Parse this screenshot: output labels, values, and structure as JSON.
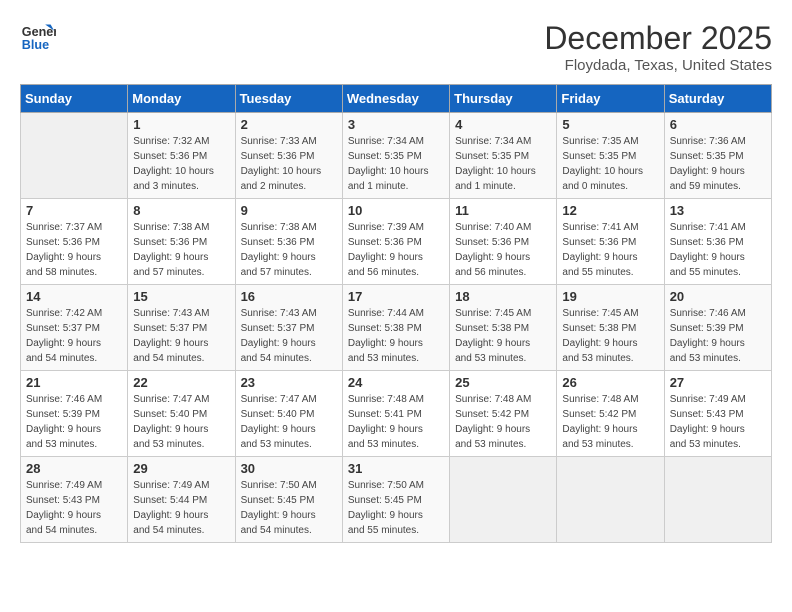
{
  "header": {
    "logo_line1": "General",
    "logo_line2": "Blue",
    "month": "December 2025",
    "location": "Floydada, Texas, United States"
  },
  "days_of_week": [
    "Sunday",
    "Monday",
    "Tuesday",
    "Wednesday",
    "Thursday",
    "Friday",
    "Saturday"
  ],
  "weeks": [
    [
      {
        "num": "",
        "info": ""
      },
      {
        "num": "1",
        "info": "Sunrise: 7:32 AM\nSunset: 5:36 PM\nDaylight: 10 hours\nand 3 minutes."
      },
      {
        "num": "2",
        "info": "Sunrise: 7:33 AM\nSunset: 5:36 PM\nDaylight: 10 hours\nand 2 minutes."
      },
      {
        "num": "3",
        "info": "Sunrise: 7:34 AM\nSunset: 5:35 PM\nDaylight: 10 hours\nand 1 minute."
      },
      {
        "num": "4",
        "info": "Sunrise: 7:34 AM\nSunset: 5:35 PM\nDaylight: 10 hours\nand 1 minute."
      },
      {
        "num": "5",
        "info": "Sunrise: 7:35 AM\nSunset: 5:35 PM\nDaylight: 10 hours\nand 0 minutes."
      },
      {
        "num": "6",
        "info": "Sunrise: 7:36 AM\nSunset: 5:35 PM\nDaylight: 9 hours\nand 59 minutes."
      }
    ],
    [
      {
        "num": "7",
        "info": "Sunrise: 7:37 AM\nSunset: 5:36 PM\nDaylight: 9 hours\nand 58 minutes."
      },
      {
        "num": "8",
        "info": "Sunrise: 7:38 AM\nSunset: 5:36 PM\nDaylight: 9 hours\nand 57 minutes."
      },
      {
        "num": "9",
        "info": "Sunrise: 7:38 AM\nSunset: 5:36 PM\nDaylight: 9 hours\nand 57 minutes."
      },
      {
        "num": "10",
        "info": "Sunrise: 7:39 AM\nSunset: 5:36 PM\nDaylight: 9 hours\nand 56 minutes."
      },
      {
        "num": "11",
        "info": "Sunrise: 7:40 AM\nSunset: 5:36 PM\nDaylight: 9 hours\nand 56 minutes."
      },
      {
        "num": "12",
        "info": "Sunrise: 7:41 AM\nSunset: 5:36 PM\nDaylight: 9 hours\nand 55 minutes."
      },
      {
        "num": "13",
        "info": "Sunrise: 7:41 AM\nSunset: 5:36 PM\nDaylight: 9 hours\nand 55 minutes."
      }
    ],
    [
      {
        "num": "14",
        "info": "Sunrise: 7:42 AM\nSunset: 5:37 PM\nDaylight: 9 hours\nand 54 minutes."
      },
      {
        "num": "15",
        "info": "Sunrise: 7:43 AM\nSunset: 5:37 PM\nDaylight: 9 hours\nand 54 minutes."
      },
      {
        "num": "16",
        "info": "Sunrise: 7:43 AM\nSunset: 5:37 PM\nDaylight: 9 hours\nand 54 minutes."
      },
      {
        "num": "17",
        "info": "Sunrise: 7:44 AM\nSunset: 5:38 PM\nDaylight: 9 hours\nand 53 minutes."
      },
      {
        "num": "18",
        "info": "Sunrise: 7:45 AM\nSunset: 5:38 PM\nDaylight: 9 hours\nand 53 minutes."
      },
      {
        "num": "19",
        "info": "Sunrise: 7:45 AM\nSunset: 5:38 PM\nDaylight: 9 hours\nand 53 minutes."
      },
      {
        "num": "20",
        "info": "Sunrise: 7:46 AM\nSunset: 5:39 PM\nDaylight: 9 hours\nand 53 minutes."
      }
    ],
    [
      {
        "num": "21",
        "info": "Sunrise: 7:46 AM\nSunset: 5:39 PM\nDaylight: 9 hours\nand 53 minutes."
      },
      {
        "num": "22",
        "info": "Sunrise: 7:47 AM\nSunset: 5:40 PM\nDaylight: 9 hours\nand 53 minutes."
      },
      {
        "num": "23",
        "info": "Sunrise: 7:47 AM\nSunset: 5:40 PM\nDaylight: 9 hours\nand 53 minutes."
      },
      {
        "num": "24",
        "info": "Sunrise: 7:48 AM\nSunset: 5:41 PM\nDaylight: 9 hours\nand 53 minutes."
      },
      {
        "num": "25",
        "info": "Sunrise: 7:48 AM\nSunset: 5:42 PM\nDaylight: 9 hours\nand 53 minutes."
      },
      {
        "num": "26",
        "info": "Sunrise: 7:48 AM\nSunset: 5:42 PM\nDaylight: 9 hours\nand 53 minutes."
      },
      {
        "num": "27",
        "info": "Sunrise: 7:49 AM\nSunset: 5:43 PM\nDaylight: 9 hours\nand 53 minutes."
      }
    ],
    [
      {
        "num": "28",
        "info": "Sunrise: 7:49 AM\nSunset: 5:43 PM\nDaylight: 9 hours\nand 54 minutes."
      },
      {
        "num": "29",
        "info": "Sunrise: 7:49 AM\nSunset: 5:44 PM\nDaylight: 9 hours\nand 54 minutes."
      },
      {
        "num": "30",
        "info": "Sunrise: 7:50 AM\nSunset: 5:45 PM\nDaylight: 9 hours\nand 54 minutes."
      },
      {
        "num": "31",
        "info": "Sunrise: 7:50 AM\nSunset: 5:45 PM\nDaylight: 9 hours\nand 55 minutes."
      },
      {
        "num": "",
        "info": ""
      },
      {
        "num": "",
        "info": ""
      },
      {
        "num": "",
        "info": ""
      }
    ]
  ]
}
